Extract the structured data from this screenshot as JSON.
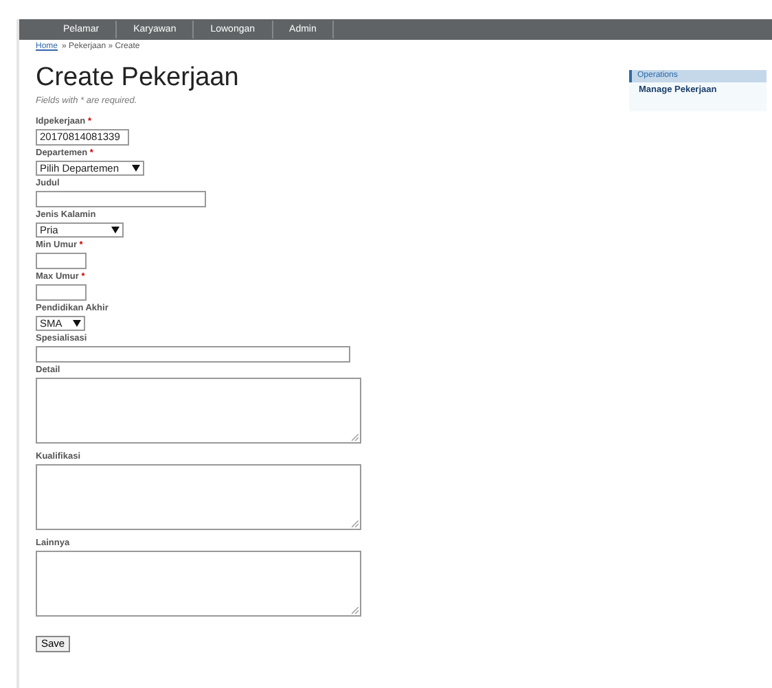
{
  "nav": [
    {
      "label": "Pelamar"
    },
    {
      "label": "Karyawan"
    },
    {
      "label": "Lowongan"
    },
    {
      "label": "Admin"
    }
  ],
  "breadcrumb": {
    "link": "Home",
    "trail": "» Pekerjaan » Create"
  },
  "title": "Create Pekerjaan",
  "note": "Fields with * are required.",
  "fields": [
    {
      "kind": "text",
      "label": "Idpekerjaan",
      "required_mark": "*",
      "value": "20170814081339"
    },
    {
      "kind": "select",
      "label": "Departemen",
      "required_mark": "*",
      "value": "Pilih Departemen"
    },
    {
      "kind": "text",
      "label": "Judul"
    },
    {
      "kind": "select",
      "label": "Jenis Kalamin",
      "value": "Pria"
    },
    {
      "kind": "text",
      "label": "Min Umur",
      "required_mark": "*"
    },
    {
      "kind": "text",
      "label": "Max Umur",
      "required_mark": "*"
    },
    {
      "kind": "select",
      "label": "Pendidikan Akhir",
      "value": "SMA"
    },
    {
      "kind": "text",
      "label": "Spesialisasi"
    },
    {
      "kind": "textarea",
      "label": "Detail"
    },
    {
      "kind": "textarea",
      "label": "Kualifikasi"
    },
    {
      "kind": "textarea",
      "label": "Lainnya"
    }
  ],
  "save_button": "Save",
  "sidebar": {
    "title": "Operations",
    "items": [
      "Manage Pekerjaan"
    ]
  }
}
